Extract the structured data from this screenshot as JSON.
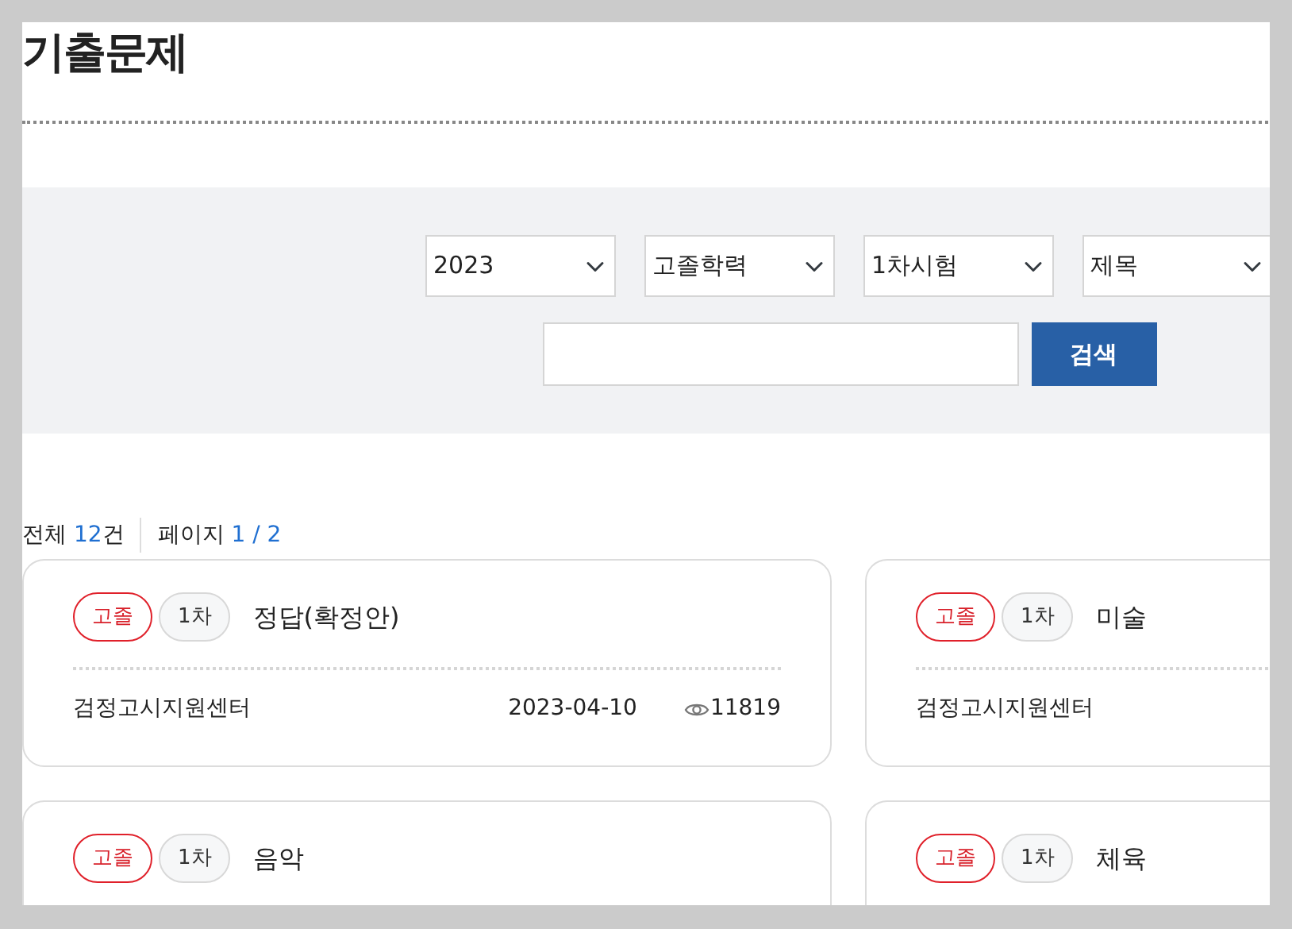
{
  "page_title": "기출문제",
  "filters": {
    "selects": [
      {
        "value": "2023"
      },
      {
        "value": "고졸학력"
      },
      {
        "value": "1차시험"
      },
      {
        "value": "제목"
      }
    ],
    "search_button": "검색"
  },
  "summary": {
    "total_label": "전체",
    "total_count": "12",
    "total_unit": "건",
    "page_label": "페이지",
    "page_current": "1",
    "page_sep": "/",
    "page_total": "2"
  },
  "cards": [
    {
      "tags": [
        {
          "kind": "level",
          "text": "고졸"
        },
        {
          "kind": "round",
          "text": "1차"
        }
      ],
      "title": "정답(확정안)",
      "author": "검정고시지원센터",
      "date": "2023-04-10",
      "views": "11819"
    },
    {
      "tags": [
        {
          "kind": "level",
          "text": "고졸"
        },
        {
          "kind": "round",
          "text": "1차"
        }
      ],
      "title": "미술",
      "author": "검정고시지원센터"
    },
    {
      "tags": [
        {
          "kind": "level",
          "text": "고졸"
        },
        {
          "kind": "round",
          "text": "1차"
        }
      ],
      "title": "음악"
    },
    {
      "tags": [
        {
          "kind": "level",
          "text": "고졸"
        },
        {
          "kind": "round",
          "text": "1차"
        }
      ],
      "title": "체육"
    }
  ]
}
